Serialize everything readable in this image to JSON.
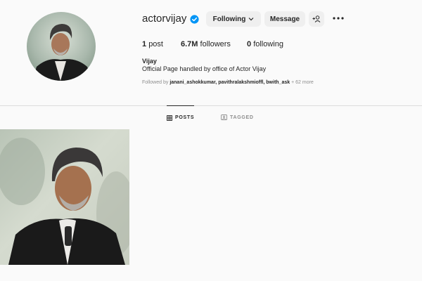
{
  "profile": {
    "username": "actorvijay",
    "full_name": "Vijay",
    "bio": "Official Page handled by office of Actor Vijay",
    "verified": true
  },
  "actions": {
    "following_label": "Following",
    "message_label": "Message"
  },
  "stats": {
    "posts_count": "1",
    "posts_label": "post",
    "followers_count": "6.7M",
    "followers_label": "followers",
    "following_count": "0",
    "following_label": "following"
  },
  "followed_by": {
    "prefix": "Followed by",
    "accounts": [
      "janani_ashokkumar,",
      "pavithralakshmioffl,",
      "bwith_ask"
    ],
    "more": "+ 62 more"
  },
  "tabs": [
    {
      "label": "POSTS",
      "active": true
    },
    {
      "label": "TAGGED",
      "active": false
    }
  ],
  "colors": {
    "verified_blue": "#0095f6",
    "background": "#fafafa",
    "button_bg": "#efefef"
  },
  "icons": {
    "verified": "verified-badge-icon",
    "chevron": "chevron-down-icon",
    "add_user": "add-user-icon",
    "more": "more-options-icon",
    "grid": "grid-icon",
    "tagged": "tagged-icon"
  }
}
